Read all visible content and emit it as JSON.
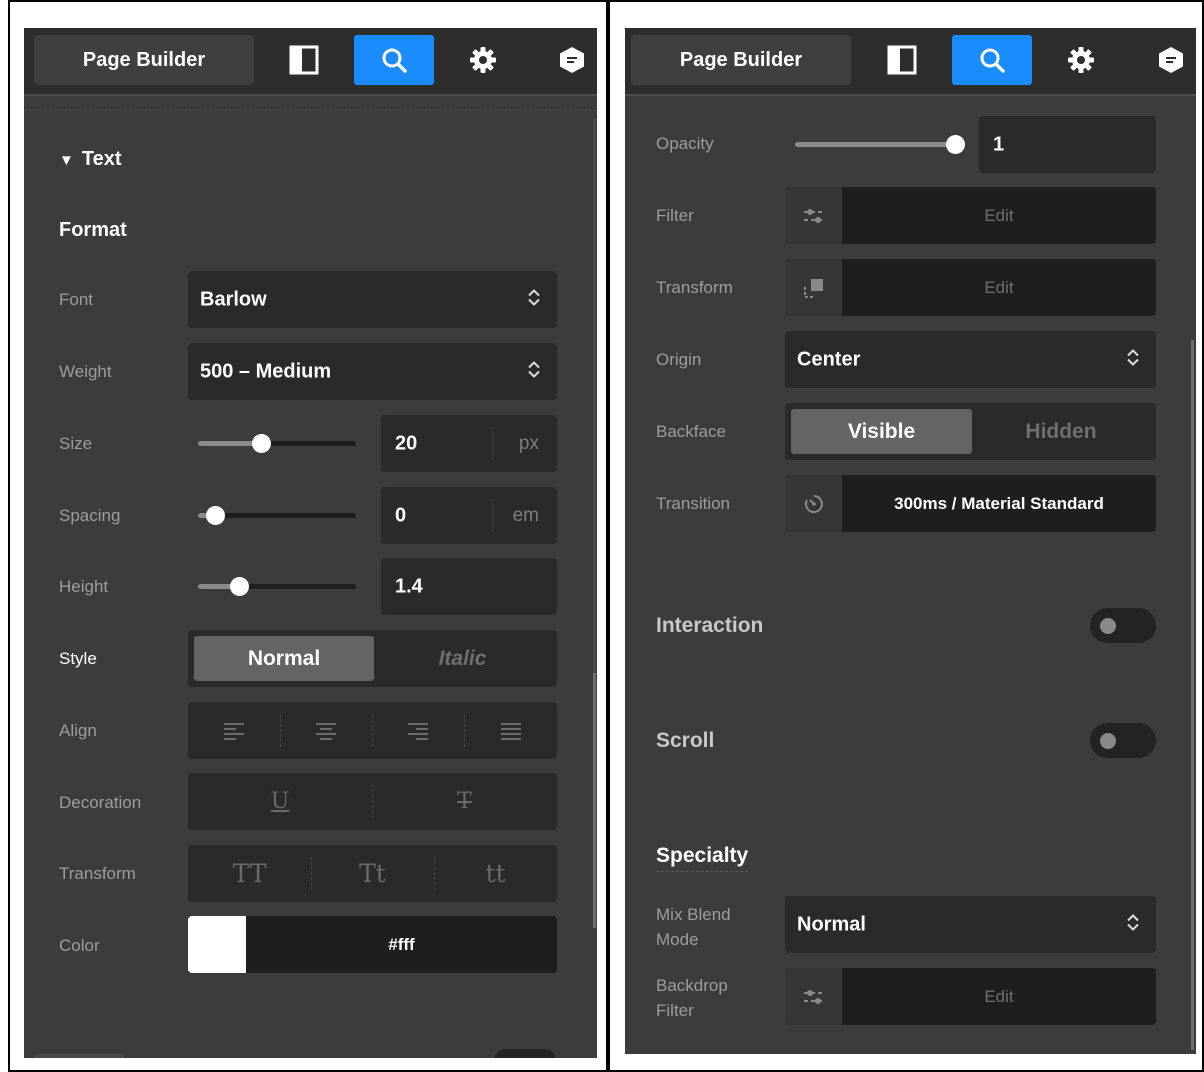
{
  "left_panel": {
    "app_title": "Page Builder",
    "section_title": "Text",
    "format_heading": "Format",
    "rows": {
      "font": {
        "label": "Font",
        "value": "Barlow"
      },
      "weight": {
        "label": "Weight",
        "value": "500 – Medium"
      },
      "size": {
        "label": "Size",
        "value": "20",
        "unit": "px",
        "slider_fraction": 0.4
      },
      "spacing": {
        "label": "Spacing",
        "value": "0",
        "unit": "em",
        "slider_fraction": 0.11
      },
      "height": {
        "label": "Height",
        "value": "1.4",
        "slider_fraction": 0.26
      },
      "style": {
        "label": "Style",
        "options": [
          "Normal",
          "Italic"
        ],
        "selected": "Normal"
      },
      "align": {
        "label": "Align",
        "icons": [
          "align-left-icon",
          "align-center-icon",
          "align-right-icon",
          "align-justify-icon"
        ]
      },
      "decoration": {
        "label": "Decoration",
        "icons": [
          "underline-icon",
          "strikethrough-icon"
        ]
      },
      "transform": {
        "label": "Transform",
        "options": [
          "TT",
          "Tt",
          "tt"
        ]
      },
      "color": {
        "label": "Color",
        "value": "#fff",
        "swatch": "#ffffff"
      }
    }
  },
  "right_panel": {
    "app_title": "Page Builder",
    "rows": {
      "opacity": {
        "label": "Opacity",
        "value": "1",
        "slider_fraction": 1.0
      },
      "filter": {
        "label": "Filter",
        "action": "Edit",
        "icon": "sliders-icon"
      },
      "transform": {
        "label": "Transform",
        "action": "Edit",
        "icon": "transform-icon"
      },
      "origin": {
        "label": "Origin",
        "value": "Center"
      },
      "backface": {
        "label": "Backface",
        "options": [
          "Visible",
          "Hidden"
        ],
        "selected": "Visible"
      },
      "transition": {
        "label": "Transition",
        "value": "300ms / Material Standard",
        "icon": "timer-icon"
      }
    },
    "interaction": {
      "label": "Interaction",
      "enabled": false
    },
    "scroll": {
      "label": "Scroll",
      "enabled": false
    },
    "specialty": {
      "heading": "Specialty",
      "mix_blend": {
        "label_line1": "Mix Blend",
        "label_line2": "Mode",
        "value": "Normal"
      },
      "backdrop": {
        "label_line1": "Backdrop",
        "label_line2": "Filter",
        "action": "Edit",
        "icon": "sliders-icon"
      }
    }
  },
  "colors": {
    "accent": "#1a8cff",
    "panel_bg": "#3c3c3c",
    "control_bg": "#2a2a2a"
  }
}
